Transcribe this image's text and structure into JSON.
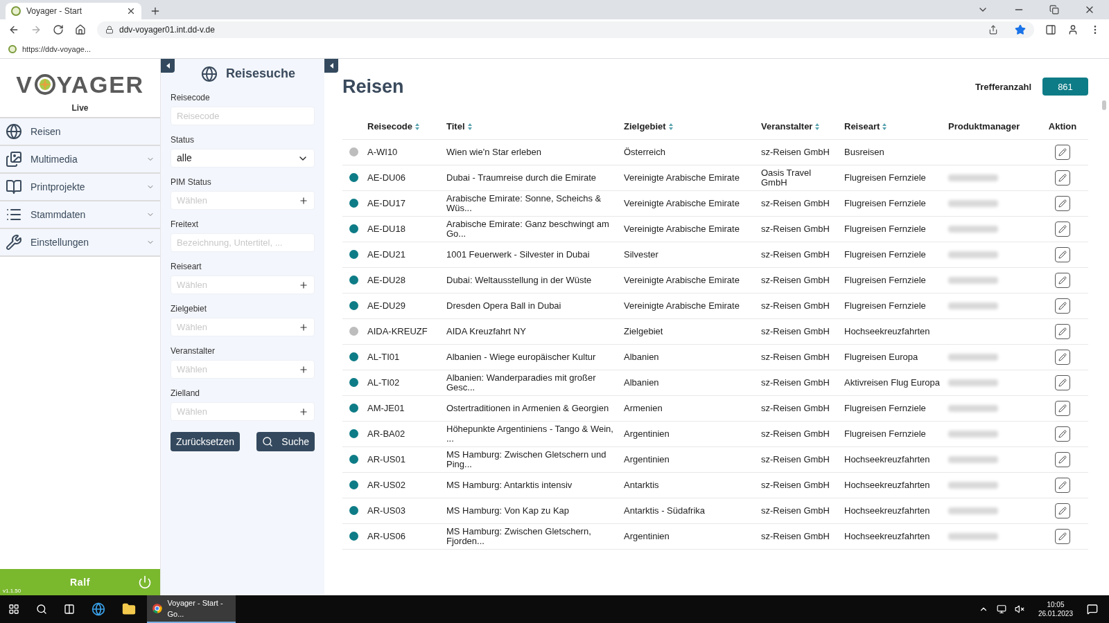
{
  "browser": {
    "tab_title": "Voyager - Start",
    "url": "ddv-voyager01.int.dd-v.de",
    "bookmark": "https://ddv-voyage..."
  },
  "sidebar": {
    "logo_left": "V",
    "logo_right": "YAGER",
    "subtitle": "Live",
    "items": [
      {
        "label": "Reisen",
        "expandable": false
      },
      {
        "label": "Multimedia",
        "expandable": true
      },
      {
        "label": "Printprojekte",
        "expandable": true
      },
      {
        "label": "Stammdaten",
        "expandable": true
      },
      {
        "label": "Einstellungen",
        "expandable": true
      }
    ],
    "user": "Ralf",
    "version": "v1.1.50"
  },
  "search": {
    "title": "Reisesuche",
    "fields": [
      {
        "label": "Reisecode",
        "kind": "text",
        "placeholder": "Reisecode"
      },
      {
        "label": "Status",
        "kind": "select",
        "value": "alle"
      },
      {
        "label": "PIM Status",
        "kind": "multi",
        "placeholder": "Wählen"
      },
      {
        "label": "Freitext",
        "kind": "text",
        "placeholder": "Bezeichnung, Untertitel, ..."
      },
      {
        "label": "Reiseart",
        "kind": "multi",
        "placeholder": "Wählen"
      },
      {
        "label": "Zielgebiet",
        "kind": "multi",
        "placeholder": "Wählen"
      },
      {
        "label": "Veranstalter",
        "kind": "multi",
        "placeholder": "Wählen"
      },
      {
        "label": "Zielland",
        "kind": "multi",
        "placeholder": "Wählen"
      }
    ],
    "reset_button": "Zurücksetzen",
    "search_button": "Suche"
  },
  "main": {
    "title": "Reisen",
    "count_label": "Trefferanzahl",
    "count": "861",
    "columns": [
      {
        "label": "Reisecode",
        "sortable": true
      },
      {
        "label": "Titel",
        "sortable": true
      },
      {
        "label": "Zielgebiet",
        "sortable": true
      },
      {
        "label": "Veranstalter",
        "sortable": true
      },
      {
        "label": "Reiseart",
        "sortable": true
      },
      {
        "label": "Produktmanager",
        "sortable": false
      },
      {
        "label": "Aktion",
        "sortable": false
      }
    ],
    "rows": [
      {
        "color": "#bdbdbd",
        "code": "A-WI10",
        "title": "Wien wie'n Star erleben",
        "region": "Österreich",
        "operator": "sz-Reisen GmbH",
        "type": "Busreisen",
        "manager_blurred": false
      },
      {
        "color": "#0e7c86",
        "code": "AE-DU06",
        "title": "Dubai - Traumreise durch die Emirate",
        "region": "Vereinigte Arabische Emirate",
        "operator": "Oasis Travel GmbH",
        "type": "Flugreisen Fernziele",
        "manager_blurred": true
      },
      {
        "color": "#0e7c86",
        "code": "AE-DU17",
        "title": "Arabische Emirate: Sonne, Scheichs & Wüs...",
        "region": "Vereinigte Arabische Emirate",
        "operator": "sz-Reisen GmbH",
        "type": "Flugreisen Fernziele",
        "manager_blurred": true
      },
      {
        "color": "#0e7c86",
        "code": "AE-DU18",
        "title": "Arabische Emirate: Ganz beschwingt am Go...",
        "region": "Vereinigte Arabische Emirate",
        "operator": "sz-Reisen GmbH",
        "type": "Flugreisen Fernziele",
        "manager_blurred": true
      },
      {
        "color": "#0e7c86",
        "code": "AE-DU21",
        "title": "1001 Feuerwerk - Silvester in Dubai",
        "region": "Silvester",
        "operator": "sz-Reisen GmbH",
        "type": "Flugreisen Fernziele",
        "manager_blurred": true
      },
      {
        "color": "#0e7c86",
        "code": "AE-DU28",
        "title": "Dubai: Weltausstellung in der Wüste",
        "region": "Vereinigte Arabische Emirate",
        "operator": "sz-Reisen GmbH",
        "type": "Flugreisen Fernziele",
        "manager_blurred": true
      },
      {
        "color": "#0e7c86",
        "code": "AE-DU29",
        "title": "Dresden Opera Ball in Dubai",
        "region": "Vereinigte Arabische Emirate",
        "operator": "sz-Reisen GmbH",
        "type": "Flugreisen Fernziele",
        "manager_blurred": true
      },
      {
        "color": "#bdbdbd",
        "code": "AIDA-KREUZF",
        "title": "AIDA Kreuzfahrt NY",
        "region": "Zielgebiet",
        "operator": "sz-Reisen GmbH",
        "type": "Hochseekreuzfahrten",
        "manager_blurred": false
      },
      {
        "color": "#0e7c86",
        "code": "AL-TI01",
        "title": "Albanien - Wiege europäischer Kultur",
        "region": "Albanien",
        "operator": "sz-Reisen GmbH",
        "type": "Flugreisen Europa",
        "manager_blurred": true
      },
      {
        "color": "#0e7c86",
        "code": "AL-TI02",
        "title": "Albanien: Wanderparadies mit großer Gesc...",
        "region": "Albanien",
        "operator": "sz-Reisen GmbH",
        "type": "Aktivreisen Flug Europa",
        "manager_blurred": true
      },
      {
        "color": "#0e7c86",
        "code": "AM-JE01",
        "title": "Ostertraditionen in Armenien & Georgien",
        "region": "Armenien",
        "operator": "sz-Reisen GmbH",
        "type": "Flugreisen Fernziele",
        "manager_blurred": true
      },
      {
        "color": "#0e7c86",
        "code": "AR-BA02",
        "title": "Höhepunkte Argentiniens - Tango & Wein, ...",
        "region": "Argentinien",
        "operator": "sz-Reisen GmbH",
        "type": "Flugreisen Fernziele",
        "manager_blurred": true
      },
      {
        "color": "#0e7c86",
        "code": "AR-US01",
        "title": "MS Hamburg: Zwischen Gletschern und Ping...",
        "region": "Argentinien",
        "operator": "sz-Reisen GmbH",
        "type": "Hochseekreuzfahrten",
        "manager_blurred": true
      },
      {
        "color": "#0e7c86",
        "code": "AR-US02",
        "title": "MS Hamburg: Antarktis intensiv",
        "region": "Antarktis",
        "operator": "sz-Reisen GmbH",
        "type": "Hochseekreuzfahrten",
        "manager_blurred": true
      },
      {
        "color": "#0e7c86",
        "code": "AR-US03",
        "title": "MS Hamburg: Von Kap zu Kap",
        "region": "Antarktis - Südafrika",
        "operator": "sz-Reisen GmbH",
        "type": "Hochseekreuzfahrten",
        "manager_blurred": true
      },
      {
        "color": "#0e7c86",
        "code": "AR-US06",
        "title": "MS Hamburg: Zwischen Gletschern, Fjorden...",
        "region": "Argentinien",
        "operator": "sz-Reisen GmbH",
        "type": "Hochseekreuzfahrten",
        "manager_blurred": true
      }
    ]
  },
  "taskbar": {
    "app": "Voyager - Start - Go...",
    "time": "10:05",
    "date": "26.01.2023"
  }
}
